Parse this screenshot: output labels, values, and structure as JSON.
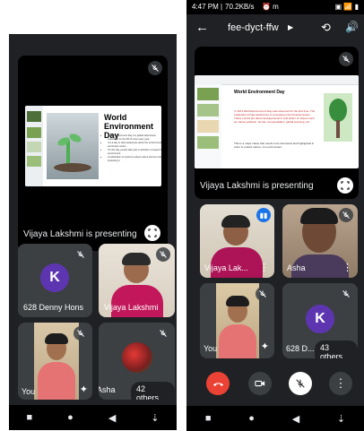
{
  "left": {
    "presenter_caption": "Vijaya Lakshmi  is presenting",
    "slide": {
      "title": "World Environment Day",
      "bullets": [
        "World Environment Day is a global observance celebrated on the 5th of June every year.",
        "It is a day to raise awareness about the environment and inspire action.",
        "On this day, people take part in activities to support the environment.",
        "A celebration to remind us about nature and our role in protecting it."
      ]
    },
    "participants": [
      {
        "name": "628 Denny Hons",
        "avatar_letter": "K"
      },
      {
        "name": "Vijaya Lakshmi"
      },
      {
        "name": "You"
      },
      {
        "name": "Asha",
        "others": "42 others"
      }
    ],
    "nav": [
      "■",
      "●",
      "◀",
      "⇣"
    ]
  },
  "right": {
    "status_bar": {
      "time": "4:47 PM",
      "speed": "70.2KB/s",
      "icons": "⏰ m",
      "right": "▣ 📶 ▮"
    },
    "meeting_code": "fee-dyct-ffw",
    "presenter_caption": "Vijaya Lakshmi  is presenting",
    "slide": {
      "title": "World Environment Day",
      "body": "In 1974 World Environment Day was observed for the first time. The celebration brings awareness to emerging environmental issues. These events are about developments in and action on issues such as marine pollution, human overpopulation, global warming, etc.",
      "body2": "This is a major cause that needs to be discussed and highlighted in order to protect nature, our environment."
    },
    "participants": [
      {
        "name": "Vijaya Lak..."
      },
      {
        "name": "Asha"
      },
      {
        "name": "You"
      },
      {
        "name": "628 D...",
        "avatar_letter": "K",
        "others": "43 others"
      }
    ],
    "nav": [
      "■",
      "●",
      "◀",
      "⇣"
    ]
  },
  "colors": {
    "accent_red": "#ea4335",
    "meet_dark": "#202124",
    "tile": "#3c4043",
    "avatar": "#5e35b1",
    "active_speaker": "#1a73e8"
  }
}
